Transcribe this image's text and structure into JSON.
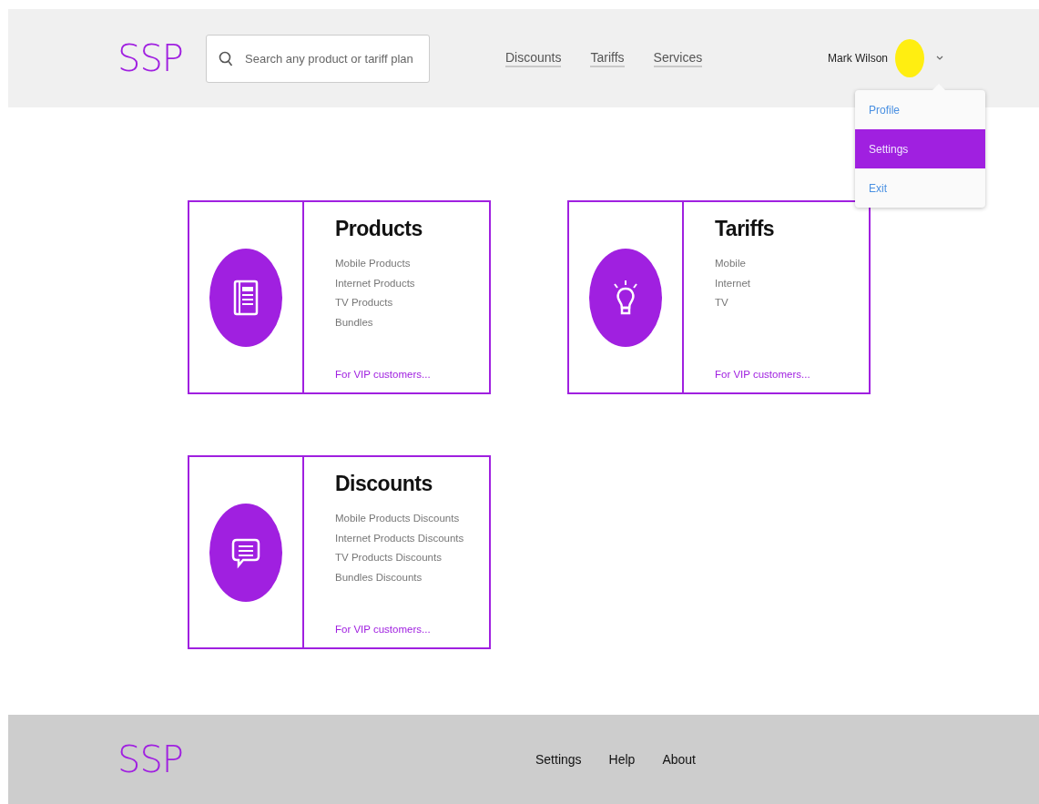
{
  "header": {
    "logo": "SSP",
    "search": {
      "placeholder": "Search any product or tariff plan"
    },
    "nav": [
      "Discounts",
      "Tariffs",
      "Services"
    ],
    "user": {
      "name": "Mark Wilson",
      "expanded": true
    },
    "user_menu": [
      {
        "label": "Profile",
        "selected": false
      },
      {
        "label": "Settings",
        "selected": true
      },
      {
        "label": "Exit",
        "selected": false
      }
    ]
  },
  "cards": [
    {
      "title": "Products",
      "items": [
        "Mobile Products",
        "Internet Products",
        "TV Products",
        "Bundles"
      ],
      "link": "For VIP customers..."
    },
    {
      "title": "Tariffs",
      "items": [
        "Mobile",
        "Internet",
        "TV"
      ],
      "link": "For VIP customers..."
    },
    {
      "title": "Discounts",
      "items": [
        "Mobile Products Discounts",
        "Internet Products Discounts",
        "TV Products Discounts",
        "Bundles Discounts"
      ],
      "link": "For VIP customers..."
    }
  ],
  "footer": {
    "logo": "SSP",
    "links": [
      "Settings",
      "Help",
      "About"
    ]
  }
}
